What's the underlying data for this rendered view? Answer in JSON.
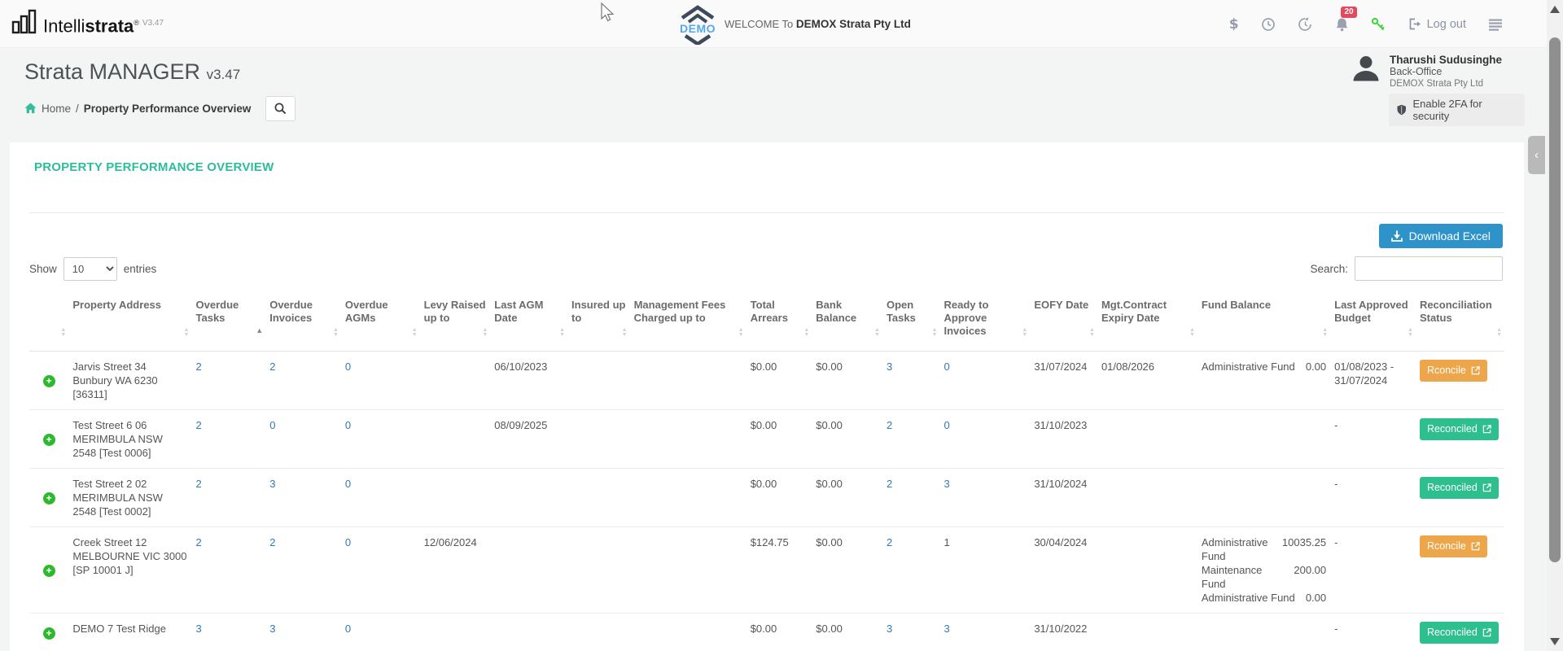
{
  "navbar": {
    "brand": {
      "name_regular": "Intelli",
      "name_bold": "strata",
      "registered": "®",
      "version": "V3.47"
    },
    "demo_badge_text": "DEMO",
    "welcome_prefix": "WELCOME To",
    "welcome_company": "DEMOX Strata Pty Ltd",
    "notification_count": "20",
    "logout_label": "Log out"
  },
  "header": {
    "title": "Strata MANAGER",
    "title_version": "v3.47",
    "breadcrumb_home": "Home",
    "breadcrumb_separator": "/",
    "breadcrumb_current": "Property Performance Overview",
    "user": {
      "name": "Tharushi Sudusinghe",
      "role": "Back-Office",
      "company": "DEMOX Strata Pty Ltd",
      "twofa_label": "Enable 2FA for security"
    }
  },
  "main": {
    "section_title": "PROPERTY PERFORMANCE OVERVIEW",
    "download_button_label": "Download Excel",
    "show_label": "Show",
    "entries_label": "entries",
    "page_size": "10",
    "search_label": "Search:",
    "search_value": "",
    "table": {
      "columns": [
        {
          "key": "expand",
          "label": ""
        },
        {
          "key": "address",
          "label": "Property Address"
        },
        {
          "key": "overdue_tasks",
          "label": "Overdue Tasks",
          "sort": "asc"
        },
        {
          "key": "overdue_invoices",
          "label": "Overdue Invoices"
        },
        {
          "key": "overdue_agms",
          "label": "Overdue AGMs"
        },
        {
          "key": "levy_raised",
          "label": "Levy Raised up to"
        },
        {
          "key": "last_agm",
          "label": "Last AGM Date"
        },
        {
          "key": "insured",
          "label": "Insured up to"
        },
        {
          "key": "mgmt_fees",
          "label": "Management Fees Charged up to"
        },
        {
          "key": "total_arrears",
          "label": "Total Arrears"
        },
        {
          "key": "bank_balance",
          "label": "Bank Balance"
        },
        {
          "key": "open_tasks",
          "label": "Open Tasks"
        },
        {
          "key": "ready",
          "label": "Ready to Approve Invoices"
        },
        {
          "key": "eofy",
          "label": "EOFY Date"
        },
        {
          "key": "mgt_expiry",
          "label": "Mgt.Contract Expiry Date"
        },
        {
          "key": "funds",
          "label": "Fund Balance"
        },
        {
          "key": "last_budget",
          "label": "Last Approved Budget"
        },
        {
          "key": "status",
          "label": "Reconciliation Status"
        }
      ],
      "rows": [
        {
          "address": "Jarvis Street 34 Bunbury WA 6230 [36311]",
          "overdue_tasks": "2",
          "overdue_invoices": "2",
          "overdue_agms": "0",
          "levy_raised": "",
          "last_agm": "06/10/2023",
          "insured": "",
          "mgmt_fees": "",
          "total_arrears": "$0.00",
          "bank_balance": "$0.00",
          "open_tasks": "3",
          "ready": "0",
          "ready_is_link": true,
          "eofy": "31/07/2024",
          "mgt_expiry": "01/08/2026",
          "funds": [
            {
              "name": "Administrative Fund",
              "amount": "0.00"
            }
          ],
          "last_budget": "01/08/2023 - 31/07/2024",
          "status": {
            "label": "Rconcile",
            "type": "warning"
          }
        },
        {
          "address": "Test Street 6 06 MERIMBULA NSW 2548 [Test 0006]",
          "overdue_tasks": "2",
          "overdue_invoices": "0",
          "overdue_agms": "0",
          "levy_raised": "",
          "last_agm": "08/09/2025",
          "insured": "",
          "mgmt_fees": "",
          "total_arrears": "$0.00",
          "bank_balance": "$0.00",
          "open_tasks": "2",
          "ready": "0",
          "ready_is_link": true,
          "eofy": "31/10/2023",
          "mgt_expiry": "",
          "funds": [],
          "last_budget": "-",
          "status": {
            "label": "Reconciled",
            "type": "success"
          }
        },
        {
          "address": "Test Street 2 02 MERIMBULA NSW 2548 [Test 0002]",
          "overdue_tasks": "2",
          "overdue_invoices": "3",
          "overdue_agms": "0",
          "levy_raised": "",
          "last_agm": "",
          "insured": "",
          "mgmt_fees": "",
          "total_arrears": "$0.00",
          "bank_balance": "$0.00",
          "open_tasks": "2",
          "ready": "3",
          "ready_is_link": true,
          "eofy": "31/10/2024",
          "mgt_expiry": "",
          "funds": [],
          "last_budget": "-",
          "status": {
            "label": "Reconciled",
            "type": "success"
          }
        },
        {
          "address": "Creek Street 12 MELBOURNE VIC 3000 [SP 10001 J]",
          "overdue_tasks": "2",
          "overdue_invoices": "2",
          "overdue_agms": "0",
          "levy_raised": "12/06/2024",
          "last_agm": "",
          "insured": "",
          "mgmt_fees": "",
          "total_arrears": "$124.75",
          "bank_balance": "$0.00",
          "open_tasks": "2",
          "ready": "1",
          "ready_is_link": false,
          "eofy": "30/04/2024",
          "mgt_expiry": "",
          "funds": [
            {
              "name": "Administrative Fund",
              "amount": "10035.25"
            },
            {
              "name": "Maintenance Fund",
              "amount": "200.00"
            },
            {
              "name": "Administrative Fund",
              "amount": "0.00"
            }
          ],
          "last_budget": "-",
          "status": {
            "label": "Rconcile",
            "type": "warning"
          }
        },
        {
          "address": "DEMO 7 Test Ridge",
          "overdue_tasks": "3",
          "overdue_invoices": "3",
          "overdue_agms": "0",
          "levy_raised": "",
          "last_agm": "",
          "insured": "",
          "mgmt_fees": "",
          "total_arrears": "$0.00",
          "bank_balance": "$0.00",
          "open_tasks": "3",
          "ready": "3",
          "ready_is_link": true,
          "eofy": "31/10/2022",
          "mgt_expiry": "",
          "funds": [],
          "last_budget": "-",
          "status": {
            "label": "Reconciled",
            "type": "success"
          }
        }
      ]
    }
  },
  "icons": {
    "collapse_chevron": "‹",
    "plus": "+",
    "dollar": "$",
    "caret_up": "▲",
    "caret_down": "▼"
  },
  "colors": {
    "accent_green": "#2dbd9d",
    "link_blue": "#3279b7",
    "download_blue": "#2e93c9",
    "warning_orange": "#eea64a",
    "success_green": "#2ebf8f",
    "badge_red": "#e5495d",
    "key_green": "#3ed43e",
    "demo_blue": "#54a8ea",
    "plus_green": "#2eb82e"
  }
}
